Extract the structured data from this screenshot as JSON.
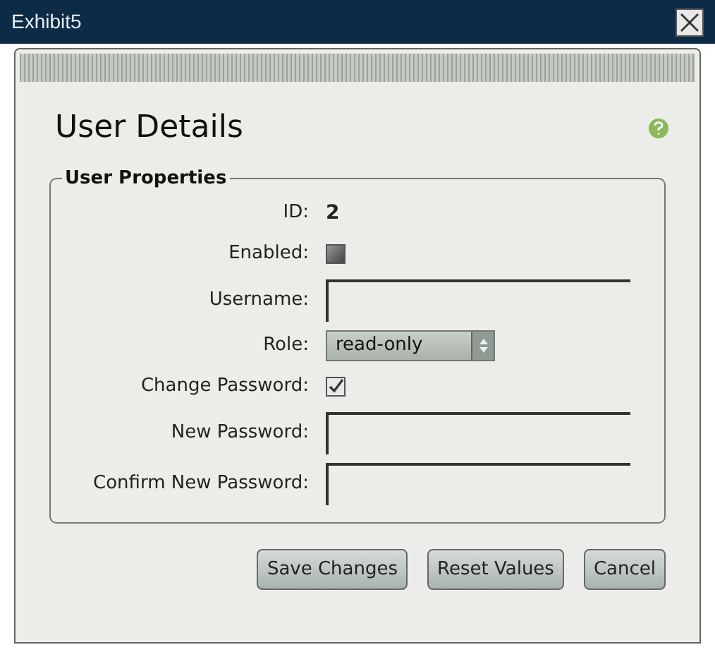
{
  "window": {
    "title": "Exhibit5"
  },
  "dialog": {
    "title": "User Details"
  },
  "fieldset": {
    "legend": "User Properties",
    "fields": [
      {
        "kind": "text",
        "label": "ID:",
        "value": "2"
      },
      {
        "kind": "checkbox",
        "label": "Enabled:",
        "checked": false
      },
      {
        "kind": "input",
        "label": "Username:"
      },
      {
        "kind": "select",
        "label": "Role:",
        "value": "read-only"
      },
      {
        "kind": "checkbox",
        "label": "Change Password:",
        "checked": true
      },
      {
        "kind": "input",
        "label": "New Password:"
      },
      {
        "kind": "input",
        "label": "Confirm New Password:"
      }
    ]
  },
  "buttons": [
    "Save Changes",
    "Reset Values",
    "Cancel"
  ]
}
